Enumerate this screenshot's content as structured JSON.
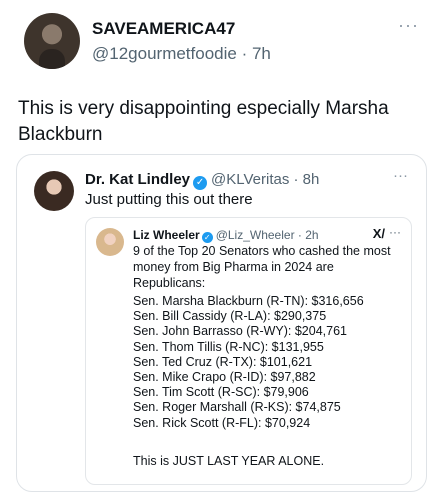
{
  "tweet": {
    "author_name": "SAVEAMERICA47",
    "handle_time": "@12gourmetfoodie · 7h",
    "more": "···",
    "text": "This is very disappointing especially Marsha Blackburn"
  },
  "quote": {
    "author_name": "Dr. Kat Lindley",
    "handle_time": "@KLVeritas · 8h",
    "more": "···",
    "text": "Just putting this out there",
    "verified_mark": "✓"
  },
  "inner": {
    "author_name": "Liz Wheeler",
    "handle_time": "@Liz_Wheeler · 2h",
    "grok": "X/",
    "more": "···",
    "verified_mark": "✓",
    "intro": "9 of the Top 20 Senators who cashed the most money from Big Pharma in 2024 are Republicans:",
    "senators": [
      "Sen. Marsha Blackburn (R-TN): $316,656",
      "Sen. Bill Cassidy (R-LA): $290,375",
      "Sen. John Barrasso (R-WY): $204,761",
      "Sen. Thom Tillis (R-NC): $131,955",
      "Sen. Ted Cruz (R-TX): $101,621",
      "Sen. Mike Crapo (R-ID): $97,882",
      "Sen. Tim Scott (R-SC): $79,906",
      "Sen. Roger Marshall (R-KS): $74,875",
      "Sen. Rick Scott (R-FL): $70,924"
    ],
    "footer": "This is JUST LAST YEAR ALONE."
  },
  "colors": {
    "verified": "#1d9bf0",
    "secondary_text": "#536471",
    "border": "#dfe3e7"
  }
}
